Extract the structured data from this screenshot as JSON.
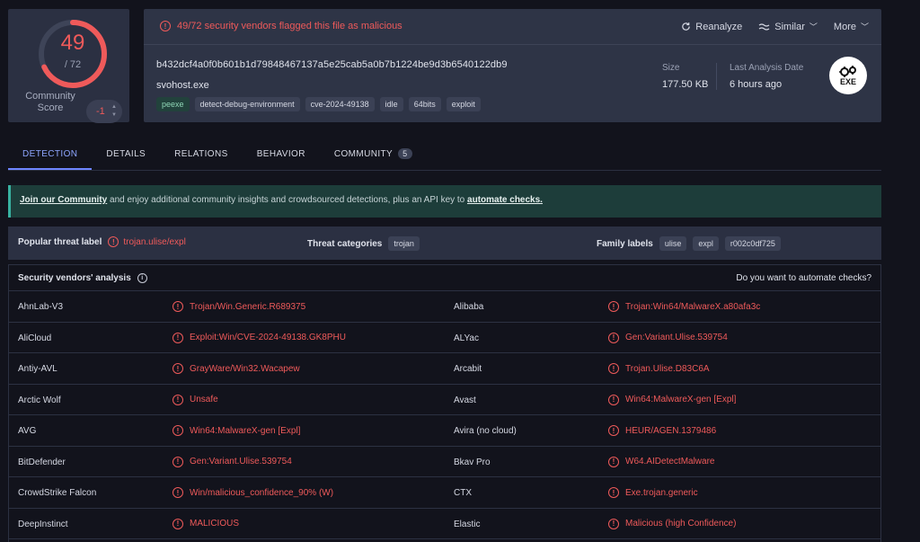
{
  "score": {
    "detected": "49",
    "total": "/ 72",
    "community_label": "Community Score",
    "community_value": "-1"
  },
  "header": {
    "flag_text": "49/72 security vendors flagged this file as malicious",
    "actions": {
      "reanalyze": "Reanalyze",
      "similar": "Similar",
      "more": "More"
    },
    "hash": "b432dcf4a0f0b601b1d79848467137a5e25cab5a0b7b1224be9d3b6540122db9",
    "filename": "svohost.exe",
    "tags": [
      "peexe",
      "detect-debug-environment",
      "cve-2024-49138",
      "idle",
      "64bits",
      "exploit"
    ],
    "size_label": "Size",
    "size_value": "177.50 KB",
    "last_label": "Last Analysis Date",
    "last_value": "6 hours ago",
    "file_type": "EXE"
  },
  "tabs": [
    {
      "label": "DETECTION"
    },
    {
      "label": "DETAILS"
    },
    {
      "label": "RELATIONS"
    },
    {
      "label": "BEHAVIOR"
    },
    {
      "label": "COMMUNITY",
      "badge": "5"
    }
  ],
  "banner": {
    "join_link": "Join our Community",
    "middle": " and enjoy additional community insights and crowdsourced detections, plus an API key to ",
    "api_link": "automate checks."
  },
  "threat": {
    "popular_label": "Popular threat label",
    "popular_value": "trojan.ulise/expl",
    "categories_label": "Threat categories",
    "categories": [
      "trojan"
    ],
    "family_label": "Family labels",
    "families": [
      "ulise",
      "expl",
      "r002c0df725"
    ]
  },
  "vendors": {
    "title": "Security vendors' analysis",
    "automate": "Do you want to automate checks?",
    "rows": [
      [
        {
          "name": "AhnLab-V3",
          "result": "Trojan/Win.Generic.R689375"
        },
        {
          "name": "Alibaba",
          "result": "Trojan:Win64/MalwareX.a80afa3c"
        }
      ],
      [
        {
          "name": "AliCloud",
          "result": "Exploit:Win/CVE-2024-49138.GK8PHU"
        },
        {
          "name": "ALYac",
          "result": "Gen:Variant.Ulise.539754"
        }
      ],
      [
        {
          "name": "Antiy-AVL",
          "result": "GrayWare/Win32.Wacapew"
        },
        {
          "name": "Arcabit",
          "result": "Trojan.Ulise.D83C6A"
        }
      ],
      [
        {
          "name": "Arctic Wolf",
          "result": "Unsafe"
        },
        {
          "name": "Avast",
          "result": "Win64:MalwareX-gen [Expl]"
        }
      ],
      [
        {
          "name": "AVG",
          "result": "Win64:MalwareX-gen [Expl]"
        },
        {
          "name": "Avira (no cloud)",
          "result": "HEUR/AGEN.1379486"
        }
      ],
      [
        {
          "name": "BitDefender",
          "result": "Gen:Variant.Ulise.539754"
        },
        {
          "name": "Bkav Pro",
          "result": "W64.AIDetectMalware"
        }
      ],
      [
        {
          "name": "CrowdStrike Falcon",
          "result": "Win/malicious_confidence_90% (W)"
        },
        {
          "name": "CTX",
          "result": "Exe.trojan.generic"
        }
      ],
      [
        {
          "name": "DeepInstinct",
          "result": "MALICIOUS"
        },
        {
          "name": "Elastic",
          "result": "Malicious (high Confidence)"
        }
      ]
    ]
  },
  "colors": {
    "accent": "#6f86ff",
    "danger": "#ef5a5a",
    "panel": "#2e3446",
    "banner": "#1d3d3a"
  }
}
